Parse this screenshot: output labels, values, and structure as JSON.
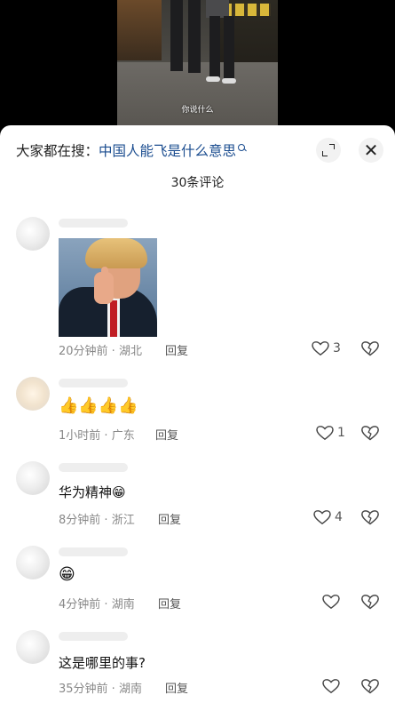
{
  "video": {
    "caption": "你说什么"
  },
  "search": {
    "prefix": "大家都在搜：",
    "query": "中国人能飞是什么意思"
  },
  "header": {
    "comment_count": "30条评论"
  },
  "comments": [
    {
      "text": "",
      "has_image": true,
      "time": "20分钟前",
      "location": "湖北",
      "reply": "回复",
      "likes": "3",
      "liked_count_visible": true
    },
    {
      "text": "👍👍👍👍",
      "time": "1小时前",
      "location": "广东",
      "reply": "回复",
      "likes": "1"
    },
    {
      "text": "华为精神😁",
      "time": "8分钟前",
      "location": "浙江",
      "reply": "回复",
      "likes": "4"
    },
    {
      "text": "😁",
      "time": "4分钟前",
      "location": "湖南",
      "reply": "回复",
      "likes": ""
    },
    {
      "text": "这是哪里的事?",
      "time": "35分钟前",
      "location": "湖南",
      "reply": "回复",
      "likes": ""
    }
  ],
  "meta_separator": " · ",
  "icons": [
    "search-icon",
    "expand-icon",
    "close-icon",
    "heart-icon",
    "broken-heart-icon"
  ],
  "colors": {
    "search_query": "#1a4c8f",
    "meta_text": "#888888",
    "text": "#111111"
  }
}
